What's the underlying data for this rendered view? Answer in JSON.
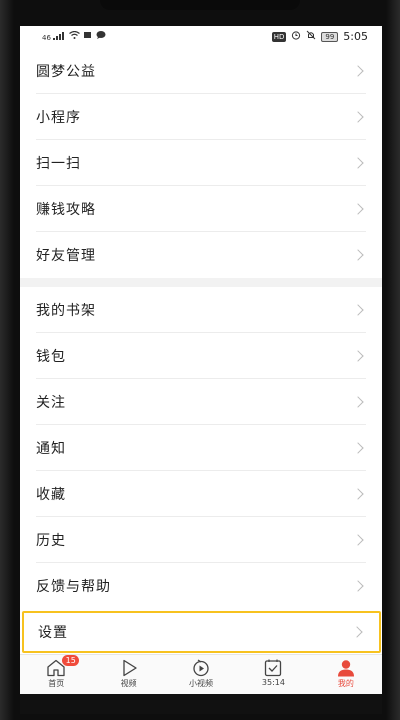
{
  "status_bar": {
    "left_icons": [
      "signal-icon",
      "wifi-icon",
      "stop-icon",
      "message-icon"
    ],
    "signal_text": "46",
    "hd_badge": "HD",
    "battery": "99",
    "time": "5:05"
  },
  "menu_group_1": [
    {
      "label": "圆梦公益"
    },
    {
      "label": "小程序"
    },
    {
      "label": "扫一扫"
    },
    {
      "label": "赚钱攻略"
    },
    {
      "label": "好友管理"
    }
  ],
  "menu_group_2": [
    {
      "label": "我的书架"
    },
    {
      "label": "钱包"
    },
    {
      "label": "关注"
    },
    {
      "label": "通知"
    },
    {
      "label": "收藏"
    },
    {
      "label": "历史"
    },
    {
      "label": "反馈与帮助"
    }
  ],
  "settings": {
    "label": "设置"
  },
  "tabbar": {
    "items": [
      {
        "label": "首页",
        "icon": "home-icon",
        "badge": "15"
      },
      {
        "label": "视频",
        "icon": "play-icon"
      },
      {
        "label": "小视频",
        "icon": "short-video-icon"
      },
      {
        "label": "35:14",
        "icon": "task-check-icon"
      },
      {
        "label": "我的",
        "icon": "profile-icon"
      }
    ],
    "active_color": "#e84a3c"
  },
  "colors": {
    "highlight": "#f7c21f",
    "badge": "#f04b3b"
  }
}
